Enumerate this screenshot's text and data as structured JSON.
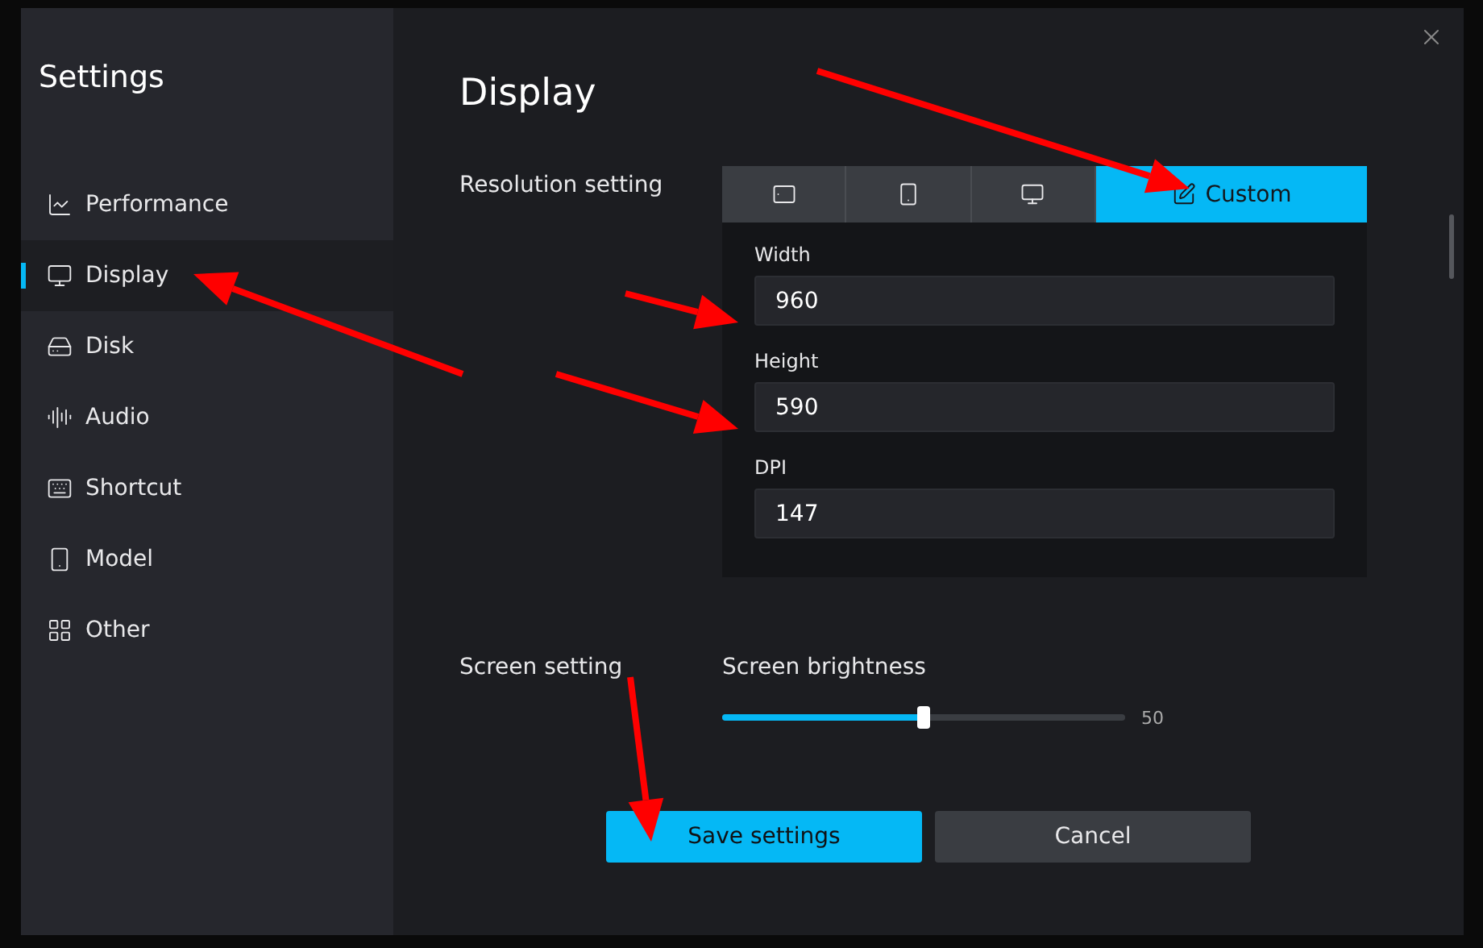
{
  "sidebar": {
    "title": "Settings",
    "items": [
      {
        "kind": "performance",
        "label": "Performance",
        "selected": false
      },
      {
        "kind": "display",
        "label": "Display",
        "selected": true
      },
      {
        "kind": "disk",
        "label": "Disk",
        "selected": false
      },
      {
        "kind": "audio",
        "label": "Audio",
        "selected": false
      },
      {
        "kind": "shortcut",
        "label": "Shortcut",
        "selected": false
      },
      {
        "kind": "model",
        "label": "Model",
        "selected": false
      },
      {
        "kind": "other",
        "label": "Other",
        "selected": false
      }
    ]
  },
  "page": {
    "title": "Display",
    "resolution": {
      "label": "Resolution setting",
      "presets": [
        {
          "kind": "tablet",
          "selected": false
        },
        {
          "kind": "phone",
          "selected": false
        },
        {
          "kind": "monitor",
          "selected": false
        },
        {
          "kind": "custom",
          "label": "Custom",
          "selected": true
        }
      ],
      "fields": [
        {
          "label": "Width",
          "value": "960"
        },
        {
          "label": "Height",
          "value": "590"
        },
        {
          "label": "DPI",
          "value": "147"
        }
      ]
    },
    "screen": {
      "label": "Screen setting",
      "brightness": {
        "label": "Screen brightness",
        "level": 0.5,
        "reading": "50"
      }
    },
    "buttons": [
      {
        "kind": "primary",
        "label": "Save settings"
      },
      {
        "kind": "secondary",
        "label": "Cancel"
      }
    ]
  }
}
